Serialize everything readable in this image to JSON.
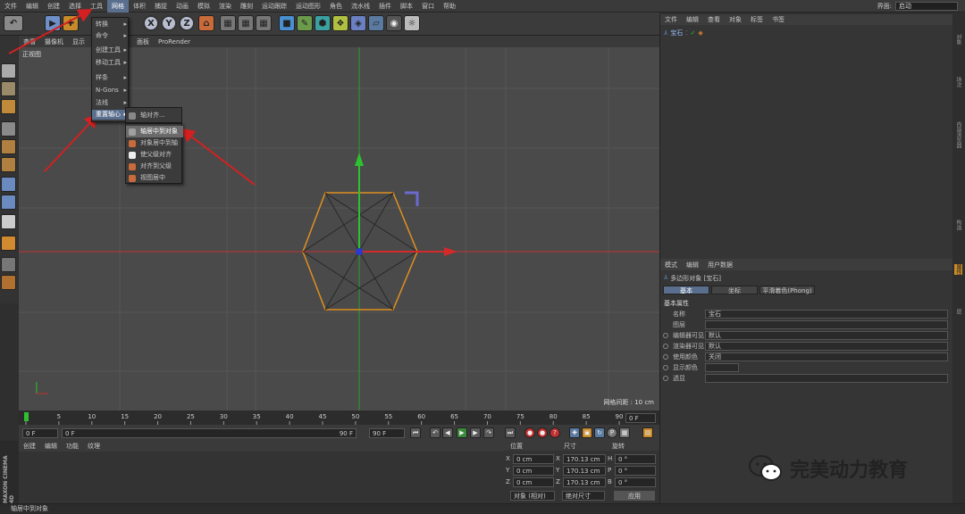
{
  "menubar": {
    "items": [
      "文件",
      "编辑",
      "创建",
      "选择",
      "工具",
      "网格",
      "体积",
      "捕捉",
      "动画",
      "模拟",
      "渲染",
      "雕刻",
      "运动跟踪",
      "运动图形",
      "角色",
      "流水线",
      "插件",
      "脚本",
      "窗口",
      "帮助"
    ],
    "active_index": 5,
    "interface_label": "界面:",
    "interface_value": "启动"
  },
  "viewport": {
    "menu": [
      "查看",
      "摄像机",
      "显示",
      "选项",
      "过滤",
      "面板",
      "ProRender"
    ],
    "view_name": "正视图",
    "status": "网格间距 : 10 cm"
  },
  "mesh_menu": {
    "items": [
      {
        "label": "转换",
        "submenu": true
      },
      {
        "label": "命令",
        "submenu": true
      },
      {
        "label": "创建工具",
        "submenu": true
      },
      {
        "label": "移动工具",
        "submenu": true
      },
      {
        "label": "样条",
        "submenu": true
      },
      {
        "label": "N-Gons",
        "submenu": true
      },
      {
        "label": "法线",
        "submenu": true
      },
      {
        "label": "重置轴心",
        "submenu": true
      }
    ],
    "selected_index": 7
  },
  "axis_submenu": {
    "header": "轴对齐...",
    "items": [
      "轴居中到对象",
      "对象居中到轴",
      "使父级对齐",
      "对齐到父级",
      "视图居中"
    ],
    "selected_index": 0
  },
  "timeline": {
    "ticks": [
      "0",
      "5",
      "10",
      "15",
      "20",
      "25",
      "30",
      "35",
      "40",
      "45",
      "50",
      "55",
      "60",
      "65",
      "70",
      "75",
      "80",
      "85",
      "90"
    ],
    "current_frame_label": "0 F"
  },
  "playbar": {
    "start": "0 F",
    "preview_start": "0 F",
    "preview_end": "90 F",
    "end": "90 F"
  },
  "material_menu": [
    "创建",
    "编辑",
    "功能",
    "纹理"
  ],
  "coordinates": {
    "headers": [
      "位置",
      "尺寸",
      "旋转"
    ],
    "rows": [
      {
        "axis": "X",
        "pos": "0 cm",
        "size": "170.13 cm",
        "rot_axis": "H",
        "rot": "0 °"
      },
      {
        "axis": "Y",
        "pos": "0 cm",
        "size": "170.13 cm",
        "rot_axis": "P",
        "rot": "0 °"
      },
      {
        "axis": "Z",
        "pos": "0 cm",
        "size": "170.13 cm",
        "rot_axis": "B",
        "rot": "0 °"
      }
    ],
    "mode": "对象 (相对)",
    "size_mode": "绝对尺寸",
    "apply": "应用"
  },
  "object_manager": {
    "menu": [
      "文件",
      "编辑",
      "查看",
      "对象",
      "标签",
      "书签"
    ],
    "object_name": "宝石"
  },
  "attributes": {
    "menu": [
      "模式",
      "编辑",
      "用户数据"
    ],
    "title": "多边形对象 [宝石]",
    "tabs": [
      "基本",
      "坐标",
      "平滑着色(Phong)"
    ],
    "active_tab": 0,
    "section": "基本属性",
    "fields": [
      {
        "label": "名称",
        "value": "宝石"
      },
      {
        "label": "图层",
        "value": ""
      },
      {
        "label": "编辑器可见",
        "value": "默认"
      },
      {
        "label": "渲染器可见",
        "value": "默认"
      },
      {
        "label": "使用颜色",
        "value": "关闭"
      },
      {
        "label": "显示颜色",
        "value": ""
      },
      {
        "label": "透显",
        "value": ""
      }
    ]
  },
  "right_strip": [
    "对象",
    "场次",
    "内容浏览器",
    "构造",
    "属性",
    "层"
  ],
  "status_bar": "轴居中到对象",
  "brand": {
    "vertical": "MAXON CINEMA 4D"
  },
  "watermark": {
    "text": "完美动力教育"
  },
  "colors": {
    "menu_highlight": "#5a6f8e",
    "axis_x": "#d42a2a",
    "axis_y": "#2ec02e",
    "hexagon": "#e09020",
    "arrow": "#d42020"
  }
}
